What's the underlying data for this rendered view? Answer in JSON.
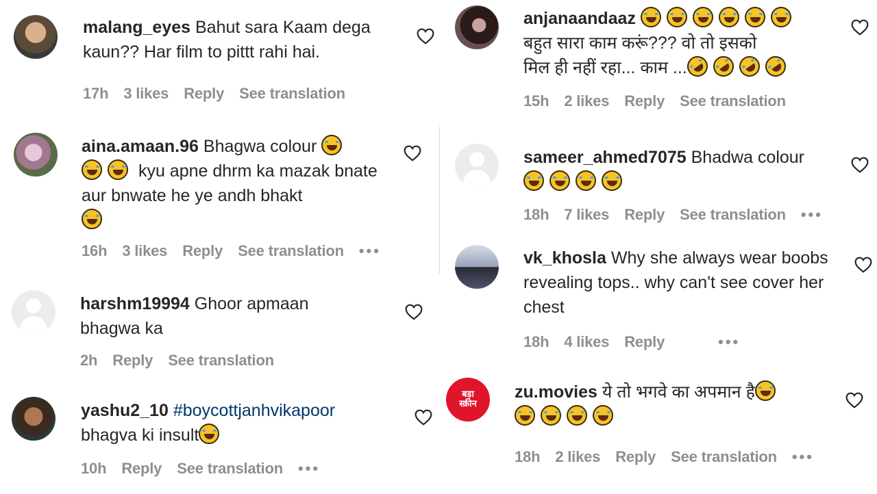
{
  "colors": {
    "username": "#262626",
    "text": "#262626",
    "meta": "#8e8e8e",
    "hashtag": "#00376b",
    "logo_red": "#e0142a"
  },
  "icons": {
    "like": "heart-outline-icon",
    "more": "more-dots-icon",
    "laugh": "joy-emoji-icon",
    "rofl": "rofl-emoji-icon"
  },
  "comments": [
    {
      "username": "malang_eyes",
      "text": "Bahut sara Kaam dega kaun?? Har film to pittt rahi hai.",
      "time": "17h",
      "likes": "3 likes",
      "reply": "Reply",
      "translate": "See translation"
    },
    {
      "username": "aina.amaan.96",
      "text_a": "Bhagwa colour",
      "text_b": "kyu apne dhrm ka mazak bnate aur bnwate he ye andh bhakt",
      "time": "16h",
      "likes": "3 likes",
      "reply": "Reply",
      "translate": "See translation",
      "more": "•••"
    },
    {
      "username": "harshm19994",
      "text": "Ghoor apmaan bhagwa ka",
      "time": "2h",
      "reply": "Reply",
      "translate": "See translation"
    },
    {
      "username": "yashu2_10",
      "hashtag": "#boycottjanhvikapoor",
      "text": "bhagva ki insult",
      "time": "10h",
      "reply": "Reply",
      "translate": "See translation",
      "more": "•••"
    },
    {
      "username": "anjanaandaaz",
      "text_a": "बहुत सारा काम करूं??? वो तो इसको",
      "text_b": "मिल ही नहीं रहा... काम ...",
      "time": "15h",
      "likes": "2 likes",
      "reply": "Reply",
      "translate": "See translation"
    },
    {
      "username": "sameer_ahmed7075",
      "text": "Bhadwa colour",
      "time": "18h",
      "likes": "7 likes",
      "reply": "Reply",
      "translate": "See translation",
      "more": "•••"
    },
    {
      "username": "vk_khosla",
      "text": "Why she always wear boobs revealing tops.. why can't see cover her chest",
      "time": "18h",
      "likes": "4 likes",
      "reply": "Reply",
      "more": "•••"
    },
    {
      "username": "zu.movies",
      "text": "ये तो भगवे का अपमान है",
      "logo_text": "बड़ा\nस्क्रीन",
      "time": "18h",
      "likes": "2 likes",
      "reply": "Reply",
      "translate": "See translation",
      "more": "•••"
    }
  ]
}
